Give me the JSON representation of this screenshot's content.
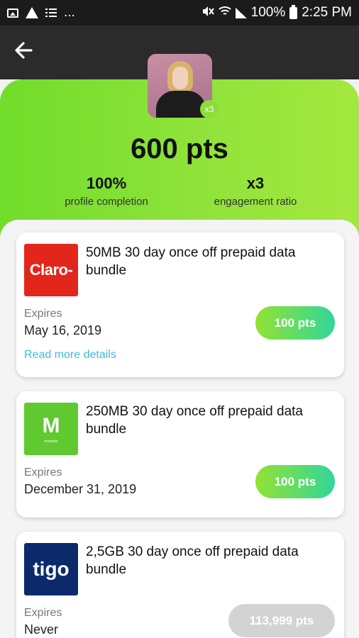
{
  "status_bar": {
    "left_dots": "...",
    "battery": "100%",
    "time": "2:25 PM"
  },
  "profile": {
    "multiplier_badge": "x3",
    "points": "600 pts",
    "completion_value": "100%",
    "completion_label": "profile completion",
    "engagement_value": "x3",
    "engagement_label": "engagement ratio"
  },
  "offers": [
    {
      "logo_text": "Claro-",
      "title": "50MB 30 day once off prepaid data bundle",
      "expires_label": "Expires",
      "expires_date": "May 16, 2019",
      "price": "100 pts",
      "read_more": "Read more details"
    },
    {
      "logo_text": "M",
      "logo_sub": "movistar",
      "title": "250MB 30 day once off prepaid data bundle",
      "expires_label": "Expires",
      "expires_date": "December 31, 2019",
      "price": "100 pts"
    },
    {
      "logo_text": "tigo",
      "title": "2,5GB 30 day once off prepaid data bundle",
      "expires_label": "Expires",
      "expires_date": "Never",
      "price": "113,999 pts"
    }
  ],
  "colors": {
    "hero_green": "#8ddc3a",
    "button_gradient_start": "#93e232",
    "button_gradient_end": "#31d69a",
    "link_blue": "#43b9e0",
    "disabled_gray": "#d3d3d3"
  },
  "icons": {
    "back": "arrow-left-icon",
    "gallery": "image-icon",
    "warning": "warning-icon",
    "list": "list-icon",
    "mute": "mute-icon",
    "wifi": "wifi-icon",
    "signal": "signal-icon",
    "battery": "battery-icon"
  }
}
